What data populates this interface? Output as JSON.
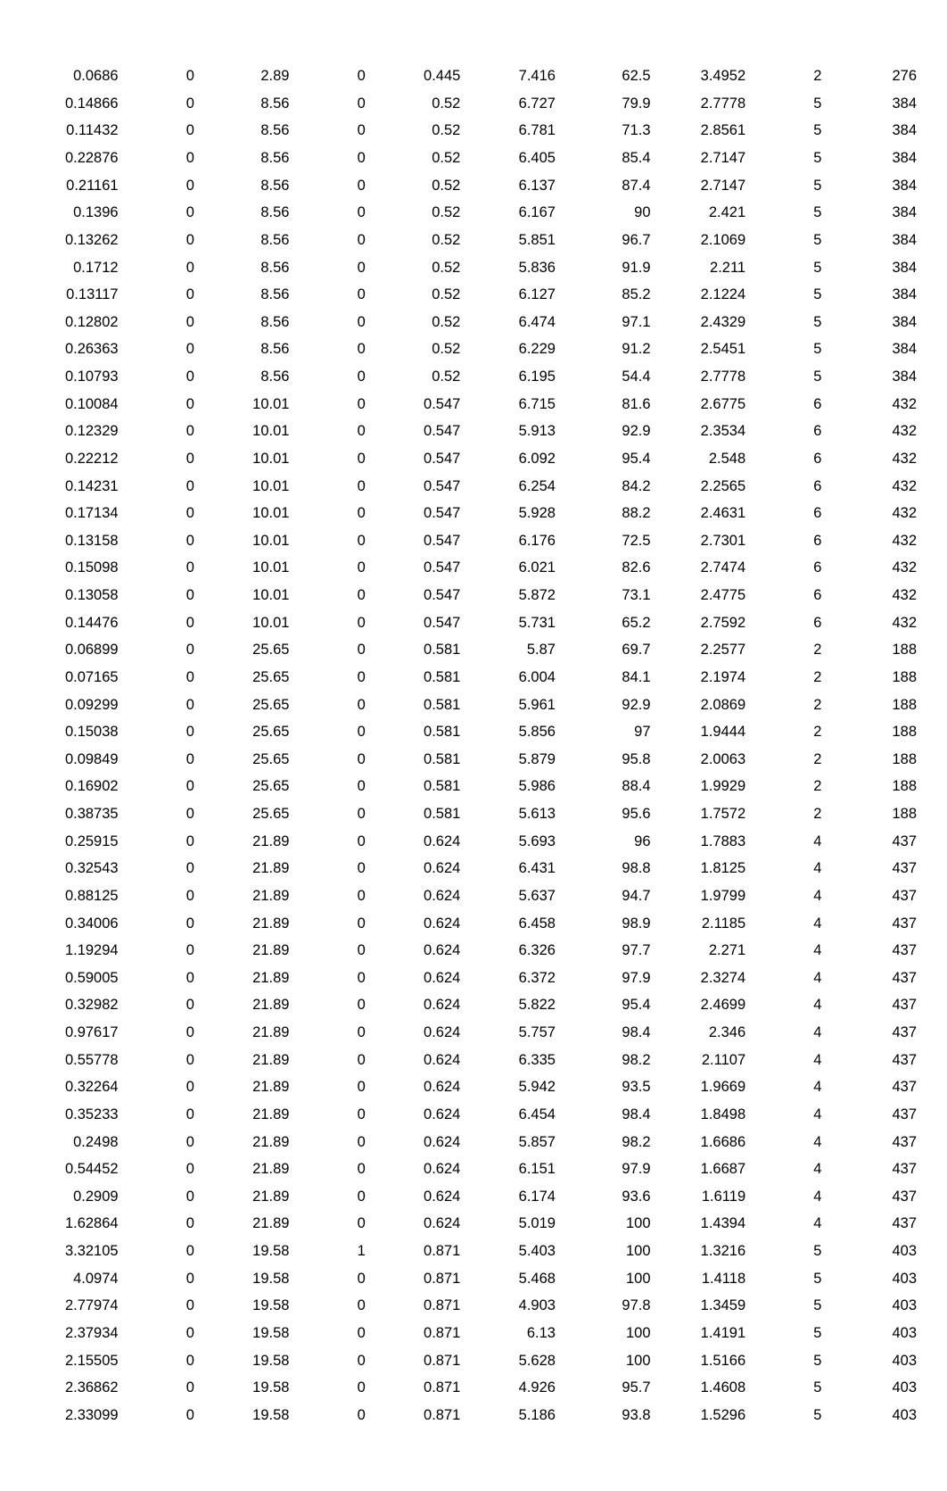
{
  "table": {
    "rows": [
      [
        0.0686,
        0,
        2.89,
        0,
        0.445,
        7.416,
        62.5,
        3.4952,
        2,
        276
      ],
      [
        0.14866,
        0,
        8.56,
        0,
        0.52,
        6.727,
        79.9,
        2.7778,
        5,
        384
      ],
      [
        0.11432,
        0,
        8.56,
        0,
        0.52,
        6.781,
        71.3,
        2.8561,
        5,
        384
      ],
      [
        0.22876,
        0,
        8.56,
        0,
        0.52,
        6.405,
        85.4,
        2.7147,
        5,
        384
      ],
      [
        0.21161,
        0,
        8.56,
        0,
        0.52,
        6.137,
        87.4,
        2.7147,
        5,
        384
      ],
      [
        0.1396,
        0,
        8.56,
        0,
        0.52,
        6.167,
        90,
        2.421,
        5,
        384
      ],
      [
        0.13262,
        0,
        8.56,
        0,
        0.52,
        5.851,
        96.7,
        2.1069,
        5,
        384
      ],
      [
        0.1712,
        0,
        8.56,
        0,
        0.52,
        5.836,
        91.9,
        2.211,
        5,
        384
      ],
      [
        0.13117,
        0,
        8.56,
        0,
        0.52,
        6.127,
        85.2,
        2.1224,
        5,
        384
      ],
      [
        0.12802,
        0,
        8.56,
        0,
        0.52,
        6.474,
        97.1,
        2.4329,
        5,
        384
      ],
      [
        0.26363,
        0,
        8.56,
        0,
        0.52,
        6.229,
        91.2,
        2.5451,
        5,
        384
      ],
      [
        0.10793,
        0,
        8.56,
        0,
        0.52,
        6.195,
        54.4,
        2.7778,
        5,
        384
      ],
      [
        0.10084,
        0,
        10.01,
        0,
        0.547,
        6.715,
        81.6,
        2.6775,
        6,
        432
      ],
      [
        0.12329,
        0,
        10.01,
        0,
        0.547,
        5.913,
        92.9,
        2.3534,
        6,
        432
      ],
      [
        0.22212,
        0,
        10.01,
        0,
        0.547,
        6.092,
        95.4,
        2.548,
        6,
        432
      ],
      [
        0.14231,
        0,
        10.01,
        0,
        0.547,
        6.254,
        84.2,
        2.2565,
        6,
        432
      ],
      [
        0.17134,
        0,
        10.01,
        0,
        0.547,
        5.928,
        88.2,
        2.4631,
        6,
        432
      ],
      [
        0.13158,
        0,
        10.01,
        0,
        0.547,
        6.176,
        72.5,
        2.7301,
        6,
        432
      ],
      [
        0.15098,
        0,
        10.01,
        0,
        0.547,
        6.021,
        82.6,
        2.7474,
        6,
        432
      ],
      [
        0.13058,
        0,
        10.01,
        0,
        0.547,
        5.872,
        73.1,
        2.4775,
        6,
        432
      ],
      [
        0.14476,
        0,
        10.01,
        0,
        0.547,
        5.731,
        65.2,
        2.7592,
        6,
        432
      ],
      [
        0.06899,
        0,
        25.65,
        0,
        0.581,
        5.87,
        69.7,
        2.2577,
        2,
        188
      ],
      [
        0.07165,
        0,
        25.65,
        0,
        0.581,
        6.004,
        84.1,
        2.1974,
        2,
        188
      ],
      [
        0.09299,
        0,
        25.65,
        0,
        0.581,
        5.961,
        92.9,
        2.0869,
        2,
        188
      ],
      [
        0.15038,
        0,
        25.65,
        0,
        0.581,
        5.856,
        97,
        1.9444,
        2,
        188
      ],
      [
        0.09849,
        0,
        25.65,
        0,
        0.581,
        5.879,
        95.8,
        2.0063,
        2,
        188
      ],
      [
        0.16902,
        0,
        25.65,
        0,
        0.581,
        5.986,
        88.4,
        1.9929,
        2,
        188
      ],
      [
        0.38735,
        0,
        25.65,
        0,
        0.581,
        5.613,
        95.6,
        1.7572,
        2,
        188
      ],
      [
        0.25915,
        0,
        21.89,
        0,
        0.624,
        5.693,
        96,
        1.7883,
        4,
        437
      ],
      [
        0.32543,
        0,
        21.89,
        0,
        0.624,
        6.431,
        98.8,
        1.8125,
        4,
        437
      ],
      [
        0.88125,
        0,
        21.89,
        0,
        0.624,
        5.637,
        94.7,
        1.9799,
        4,
        437
      ],
      [
        0.34006,
        0,
        21.89,
        0,
        0.624,
        6.458,
        98.9,
        2.1185,
        4,
        437
      ],
      [
        1.19294,
        0,
        21.89,
        0,
        0.624,
        6.326,
        97.7,
        2.271,
        4,
        437
      ],
      [
        0.59005,
        0,
        21.89,
        0,
        0.624,
        6.372,
        97.9,
        2.3274,
        4,
        437
      ],
      [
        0.32982,
        0,
        21.89,
        0,
        0.624,
        5.822,
        95.4,
        2.4699,
        4,
        437
      ],
      [
        0.97617,
        0,
        21.89,
        0,
        0.624,
        5.757,
        98.4,
        2.346,
        4,
        437
      ],
      [
        0.55778,
        0,
        21.89,
        0,
        0.624,
        6.335,
        98.2,
        2.1107,
        4,
        437
      ],
      [
        0.32264,
        0,
        21.89,
        0,
        0.624,
        5.942,
        93.5,
        1.9669,
        4,
        437
      ],
      [
        0.35233,
        0,
        21.89,
        0,
        0.624,
        6.454,
        98.4,
        1.8498,
        4,
        437
      ],
      [
        0.2498,
        0,
        21.89,
        0,
        0.624,
        5.857,
        98.2,
        1.6686,
        4,
        437
      ],
      [
        0.54452,
        0,
        21.89,
        0,
        0.624,
        6.151,
        97.9,
        1.6687,
        4,
        437
      ],
      [
        0.2909,
        0,
        21.89,
        0,
        0.624,
        6.174,
        93.6,
        1.6119,
        4,
        437
      ],
      [
        1.62864,
        0,
        21.89,
        0,
        0.624,
        5.019,
        100,
        1.4394,
        4,
        437
      ],
      [
        3.32105,
        0,
        19.58,
        1,
        0.871,
        5.403,
        100,
        1.3216,
        5,
        403
      ],
      [
        4.0974,
        0,
        19.58,
        0,
        0.871,
        5.468,
        100,
        1.4118,
        5,
        403
      ],
      [
        2.77974,
        0,
        19.58,
        0,
        0.871,
        4.903,
        97.8,
        1.3459,
        5,
        403
      ],
      [
        2.37934,
        0,
        19.58,
        0,
        0.871,
        6.13,
        100,
        1.4191,
        5,
        403
      ],
      [
        2.15505,
        0,
        19.58,
        0,
        0.871,
        5.628,
        100,
        1.5166,
        5,
        403
      ],
      [
        2.36862,
        0,
        19.58,
        0,
        0.871,
        4.926,
        95.7,
        1.4608,
        5,
        403
      ],
      [
        2.33099,
        0,
        19.58,
        0,
        0.871,
        5.186,
        93.8,
        1.5296,
        5,
        403
      ]
    ]
  }
}
